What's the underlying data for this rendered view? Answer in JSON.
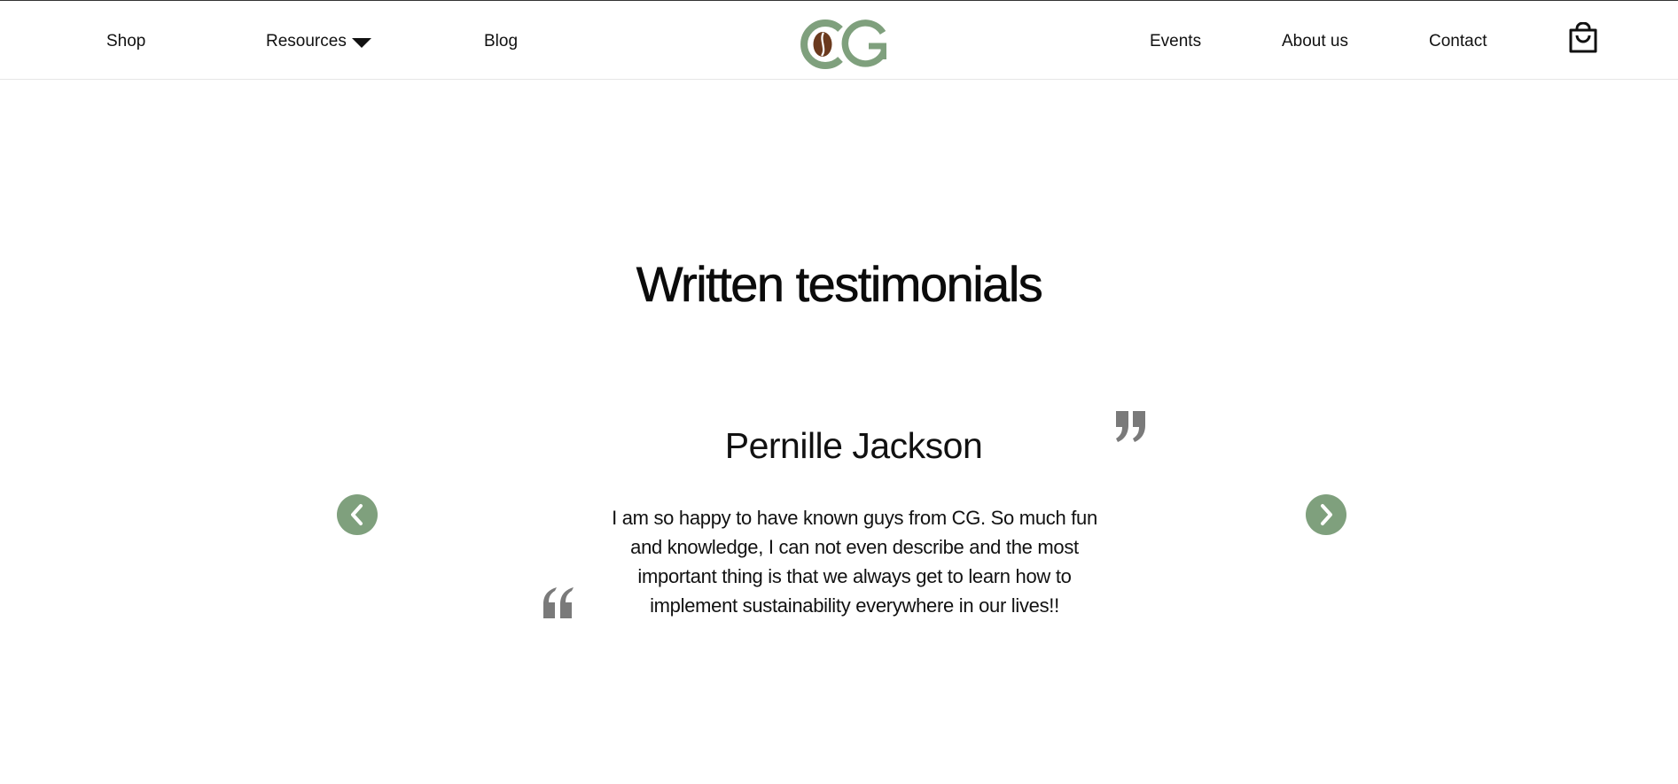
{
  "nav": {
    "shop": "Shop",
    "resources": "Resources",
    "blog": "Blog",
    "events": "Events",
    "about": "About us",
    "contact": "Contact"
  },
  "logo": {
    "text": "CG",
    "icon": "coffee-bean-logo",
    "green": "#7fa07d",
    "brown": "#6b3a1e"
  },
  "cart": {
    "icon": "shopping-bag-icon"
  },
  "testimonials": {
    "title": "Written testimonials",
    "name": "Pernille Jackson",
    "text": "I am so happy to have known guys from CG. So much fun and knowledge, I can not even describe and the most important thing is that we always get to learn how to implement sustainability everywhere in our lives!!",
    "quote_color": "#7a7a7a",
    "accent": "#7fa07d",
    "prev_icon": "chevron-left-icon",
    "next_icon": "chevron-right-icon"
  }
}
